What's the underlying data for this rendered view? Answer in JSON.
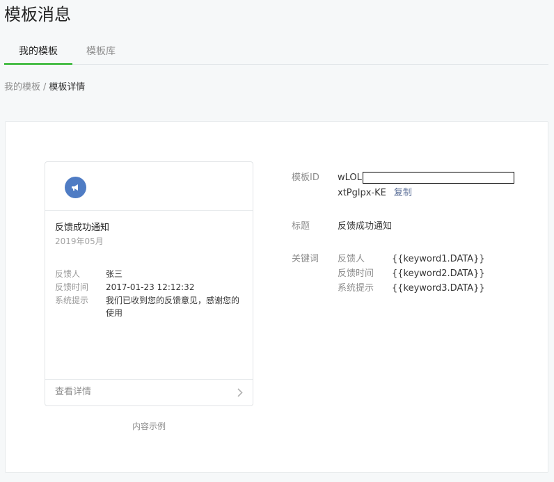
{
  "page": {
    "title": "模板消息"
  },
  "tabs": [
    {
      "label": "我的模板",
      "active": true
    },
    {
      "label": "模板库",
      "active": false
    }
  ],
  "breadcrumb": {
    "parent": "我的模板",
    "separator": "/",
    "current": "模板详情"
  },
  "preview": {
    "avatar_icon": "megaphone-icon",
    "message_title": "反馈成功通知",
    "message_date": "2019年05月",
    "fields": [
      {
        "label": "反馈人",
        "value": "张三"
      },
      {
        "label": "反馈时间",
        "value": "2017-01-23 12:12:32"
      },
      {
        "label": "系统提示",
        "value": "我们已收到您的反馈意见，感谢您的使用"
      }
    ],
    "footer_label": "查看详情",
    "caption": "内容示例"
  },
  "detail": {
    "id_label": "模板ID",
    "id_prefix": "wLOL",
    "id_suffix": "xtPglpx-KE",
    "copy_label": "复制",
    "title_label": "标题",
    "title_value": "反馈成功通知",
    "keywords_label": "关键词",
    "keywords": [
      {
        "name": "反馈人",
        "value": "{{keyword1.DATA}}"
      },
      {
        "name": "反馈时间",
        "value": "{{keyword2.DATA}}"
      },
      {
        "name": "系统提示",
        "value": "{{keyword3.DATA}}"
      }
    ]
  },
  "colors": {
    "accent": "#1aad19",
    "link": "#576b95",
    "avatar": "#4f7cc4"
  }
}
